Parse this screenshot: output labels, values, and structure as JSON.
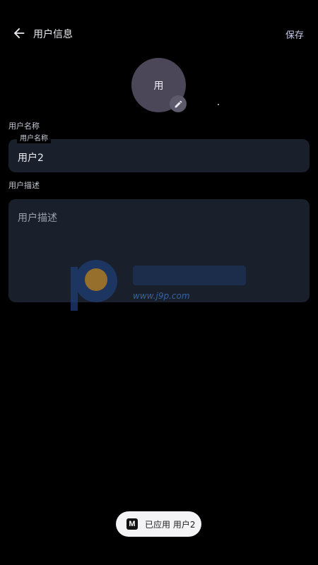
{
  "header": {
    "title": "用户信息",
    "save_label": "保存",
    "back_icon": "arrow-left-icon"
  },
  "avatar": {
    "text": "用",
    "edit_icon": "pencil-icon",
    "background": "#4b4658"
  },
  "name_section": {
    "label": "用户名称",
    "field_label": "用户名称",
    "value": "用户2"
  },
  "desc_section": {
    "label": "用户描述",
    "placeholder": "用户描述",
    "value": ""
  },
  "watermark": {
    "url": "www.j9p.com"
  },
  "toast": {
    "icon_letter": "M",
    "text": "已应用 用户2"
  },
  "colors": {
    "background": "#000000",
    "field_background": "#1a202b",
    "accent": "#c7ccef"
  }
}
